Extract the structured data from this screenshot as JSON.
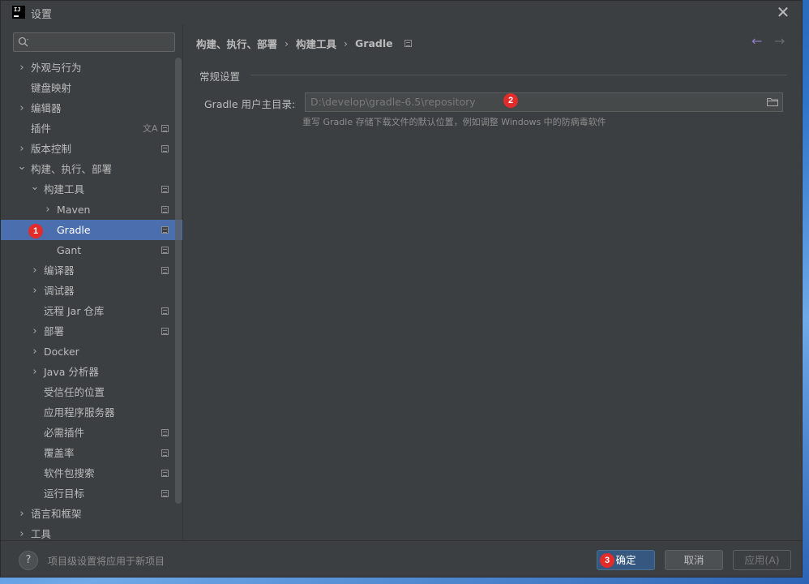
{
  "window": {
    "title": "设置"
  },
  "search": {
    "placeholder": ""
  },
  "tree": [
    {
      "label": "外观与行为",
      "level": 0,
      "chevron": "right",
      "mod": false,
      "translate": false
    },
    {
      "label": "键盘映射",
      "level": 0,
      "chevron": "",
      "mod": false,
      "translate": false
    },
    {
      "label": "编辑器",
      "level": 0,
      "chevron": "right",
      "mod": false,
      "translate": false
    },
    {
      "label": "插件",
      "level": 0,
      "chevron": "",
      "mod": true,
      "translate": true
    },
    {
      "label": "版本控制",
      "level": 0,
      "chevron": "right",
      "mod": true,
      "translate": false
    },
    {
      "label": "构建、执行、部署",
      "level": 0,
      "chevron": "down",
      "mod": false,
      "translate": false
    },
    {
      "label": "构建工具",
      "level": 1,
      "chevron": "down",
      "mod": true,
      "translate": false
    },
    {
      "label": "Maven",
      "level": 2,
      "chevron": "right",
      "mod": true,
      "translate": false
    },
    {
      "label": "Gradle",
      "level": 2,
      "chevron": "",
      "mod": true,
      "translate": false,
      "selected": true
    },
    {
      "label": "Gant",
      "level": 2,
      "chevron": "",
      "mod": true,
      "translate": false
    },
    {
      "label": "编译器",
      "level": 1,
      "chevron": "right",
      "mod": true,
      "translate": false
    },
    {
      "label": "调试器",
      "level": 1,
      "chevron": "right",
      "mod": false,
      "translate": false
    },
    {
      "label": "远程 Jar 仓库",
      "level": 1,
      "chevron": "",
      "mod": true,
      "translate": false
    },
    {
      "label": "部署",
      "level": 1,
      "chevron": "right",
      "mod": true,
      "translate": false
    },
    {
      "label": "Docker",
      "level": 1,
      "chevron": "right",
      "mod": false,
      "translate": false
    },
    {
      "label": "Java 分析器",
      "level": 1,
      "chevron": "right",
      "mod": false,
      "translate": false
    },
    {
      "label": "受信任的位置",
      "level": 1,
      "chevron": "",
      "mod": false,
      "translate": false
    },
    {
      "label": "应用程序服务器",
      "level": 1,
      "chevron": "",
      "mod": false,
      "translate": false
    },
    {
      "label": "必需插件",
      "level": 1,
      "chevron": "",
      "mod": true,
      "translate": false
    },
    {
      "label": "覆盖率",
      "level": 1,
      "chevron": "",
      "mod": true,
      "translate": false
    },
    {
      "label": "软件包搜索",
      "level": 1,
      "chevron": "",
      "mod": true,
      "translate": false
    },
    {
      "label": "运行目标",
      "level": 1,
      "chevron": "",
      "mod": true,
      "translate": false
    },
    {
      "label": "语言和框架",
      "level": 0,
      "chevron": "right",
      "mod": false,
      "translate": false
    },
    {
      "label": "工具",
      "level": 0,
      "chevron": "right",
      "mod": false,
      "translate": false
    }
  ],
  "breadcrumb": [
    "构建、执行、部署",
    "构建工具",
    "Gradle"
  ],
  "section": {
    "title": "常规设置"
  },
  "gradle_home": {
    "label": "Gradle 用户主目录:",
    "value": "D:\\develop\\gradle-6.5\\repository",
    "hint": "重写 Gradle 存储下载文件的默认位置，例如调整 Windows 中的防病毒软件"
  },
  "annotations": {
    "badge1": "1",
    "badge2": "2",
    "badge3": "3"
  },
  "footer": {
    "help": "?",
    "note": "项目级设置将应用于新项目",
    "ok": "确定",
    "cancel": "取消",
    "apply": "应用(A)"
  },
  "icons": {
    "translate": "文A",
    "chevron_right": "›",
    "chevron_down": "⌄",
    "back": "←",
    "forward": "→",
    "close": "✕"
  },
  "colors": {
    "selection": "#4b6eaf",
    "badge": "#e22b2b",
    "ok_button": "#365880",
    "back_arrow": "#8e7cc3"
  }
}
